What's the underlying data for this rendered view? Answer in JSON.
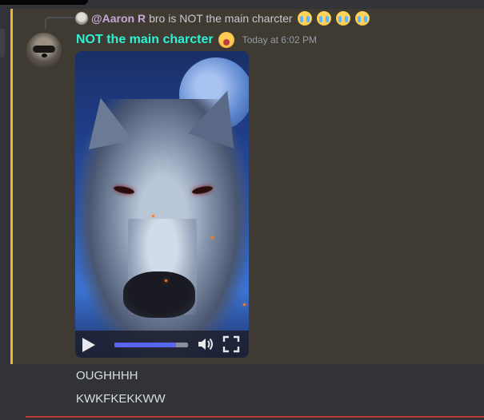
{
  "reply": {
    "mention": "@Aaron R",
    "text": "bro is NOT the main charcter",
    "emojis": [
      "loudly-crying-emoji",
      "loudly-crying-emoji",
      "loudly-crying-emoji",
      "loudly-crying-emoji"
    ]
  },
  "message": {
    "username": "NOT the main charcter",
    "username_emoji": "screaming-face-emoji",
    "timestamp": "Today at 6:02 PM",
    "video": {
      "progress_fraction": 0.84
    }
  },
  "followups": [
    {
      "text": "OUGHHHH"
    },
    {
      "text": "KWKFKEKKWW"
    }
  ],
  "colors": {
    "username": "#2cf2d5",
    "mention": "#c9a6d8",
    "highlight_bar": "#f0b232",
    "progress": "#5865f2"
  }
}
